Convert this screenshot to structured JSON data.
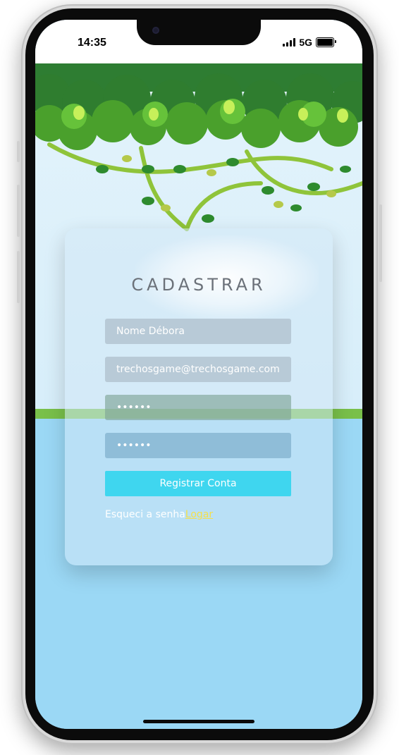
{
  "status_bar": {
    "time": "14:35",
    "network": "5G"
  },
  "form": {
    "title": "CADASTRAR",
    "name_value": "Nome Débora",
    "email_value": "trechosgame@trechosgame.com",
    "password_value": "••••••",
    "confirm_password_value": "••••••",
    "submit_label": "Registrar Conta",
    "forgot_label": "Esqueci a senha",
    "login_label": "Logar"
  },
  "colors": {
    "button": "#3fd6ef",
    "link": "#f5e04a",
    "sky": "#dff1fb",
    "water": "#9bd8f5",
    "grass": "#79c04a"
  }
}
